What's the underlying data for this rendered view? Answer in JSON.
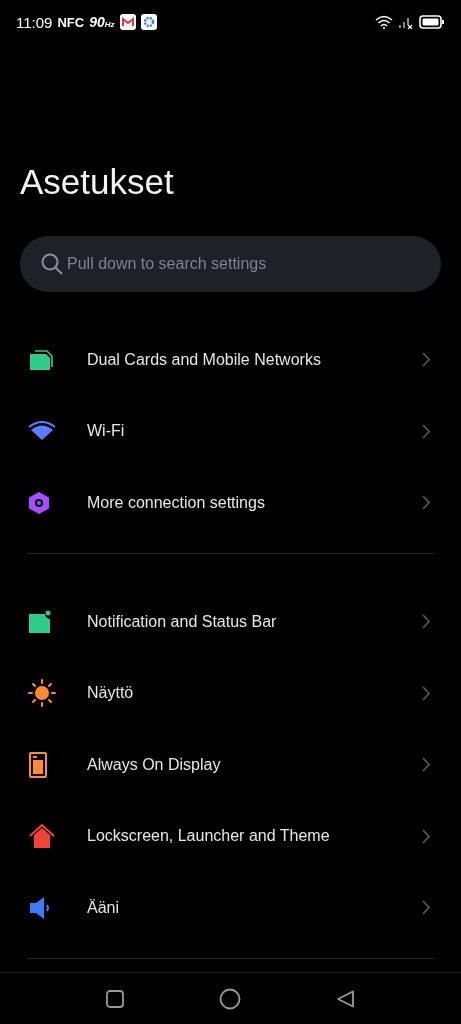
{
  "status_bar": {
    "time": "11:09",
    "nfc": "NFC",
    "refresh_rate": "90",
    "refresh_unit": "Hz"
  },
  "title": "Asetukset",
  "search": {
    "placeholder": "Pull down to search settings"
  },
  "groups": [
    {
      "items": [
        {
          "label": "Dual Cards and Mobile Networks",
          "kind": "sim"
        },
        {
          "label": "Wi-Fi",
          "kind": "wifi"
        },
        {
          "label": "More connection settings",
          "kind": "hexagon"
        }
      ]
    },
    {
      "items": [
        {
          "label": "Notification and Status Bar",
          "kind": "notification"
        },
        {
          "label": "Näyttö",
          "kind": "sun"
        },
        {
          "label": "Always On Display",
          "kind": "aod"
        },
        {
          "label": "Lockscreen, Launcher and Theme",
          "kind": "home"
        },
        {
          "label": "Ääni",
          "kind": "speaker"
        }
      ]
    }
  ]
}
